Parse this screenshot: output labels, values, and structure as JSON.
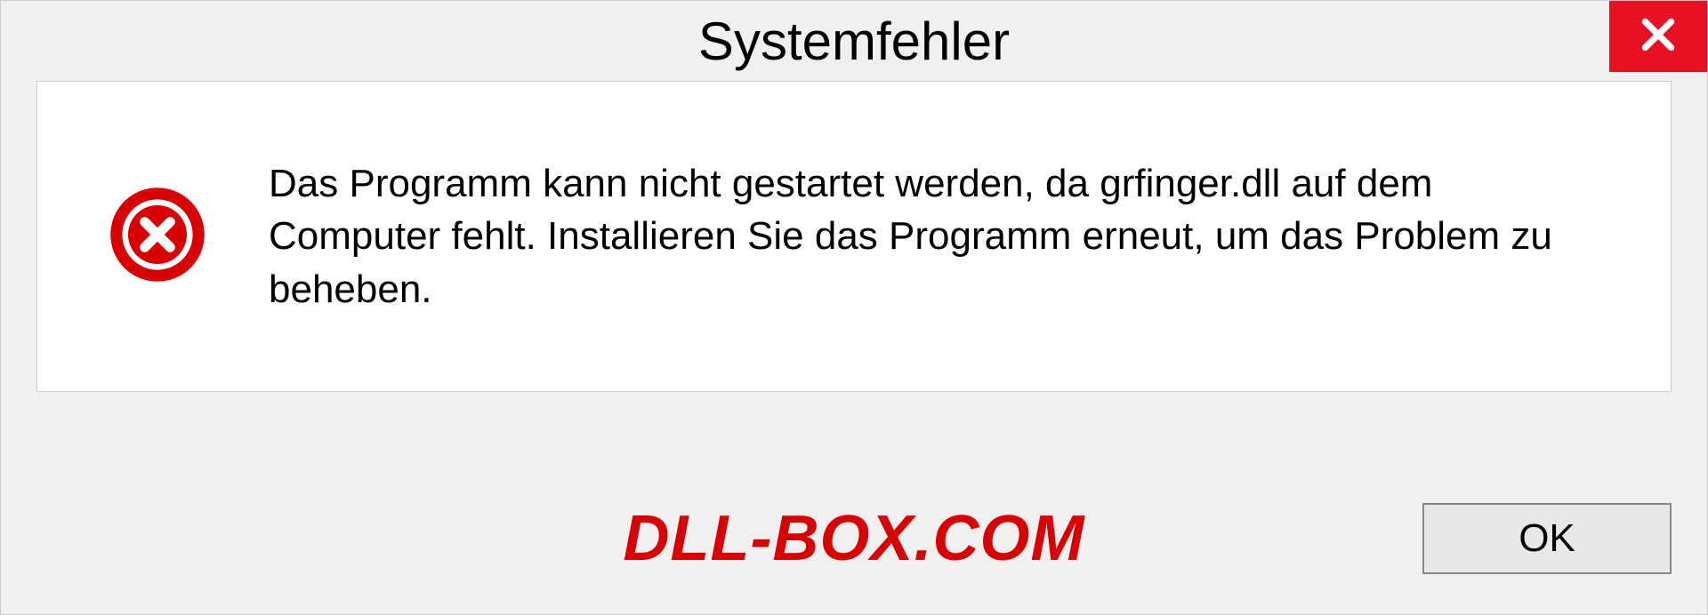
{
  "dialog": {
    "title": "Systemfehler",
    "message": "Das Programm kann nicht gestartet werden, da grfinger.dll auf dem Computer fehlt. Installieren Sie das Programm erneut, um das Problem zu beheben.",
    "ok_label": "OK"
  },
  "watermark": "DLL-BOX.COM",
  "colors": {
    "close_button": "#e81123",
    "error_icon": "#d80000",
    "watermark": "#d80000"
  }
}
